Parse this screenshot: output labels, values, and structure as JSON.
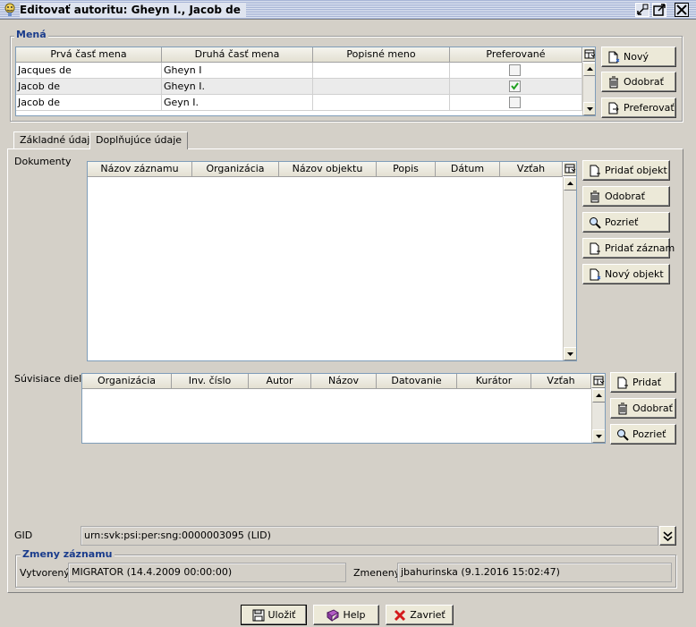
{
  "window": {
    "title": "Editovať autoritu: Gheyn I., Jacob de"
  },
  "names_group": {
    "legend": "Mená",
    "columns": [
      "Prvá časť mena",
      "Druhá časť mena",
      "Popisné meno",
      "Preferované"
    ],
    "rows": [
      {
        "first": "Jacques de",
        "second": "Gheyn I",
        "descriptive": "",
        "preferred": false
      },
      {
        "first": "Jacob de",
        "second": "Gheyn I.",
        "descriptive": "",
        "preferred": true
      },
      {
        "first": "Jacob de",
        "second": "Geyn I.",
        "descriptive": "",
        "preferred": false
      }
    ],
    "buttons": {
      "new": "Nový",
      "remove": "Odobrať",
      "prefer": "Preferovať"
    }
  },
  "tabs": [
    {
      "label": "Základné údaje",
      "active": false
    },
    {
      "label": "Doplňujúce údaje",
      "active": true
    }
  ],
  "documents": {
    "label": "Dokumenty",
    "columns": [
      "Názov záznamu",
      "Organizácia",
      "Názov objektu",
      "Popis",
      "Dátum",
      "Vzťah"
    ],
    "buttons": {
      "add_object": "Pridať objekt",
      "remove": "Odobrať",
      "view": "Pozrieť",
      "add_record": "Pridať záznam",
      "new_object": "Nový objekt"
    }
  },
  "related": {
    "label": "Súvisiace diela",
    "columns": [
      "Organizácia",
      "Inv. číslo",
      "Autor",
      "Názov",
      "Datovanie",
      "Kurátor",
      "Vzťah"
    ],
    "buttons": {
      "add": "Pridať",
      "remove": "Odobrať",
      "view": "Pozrieť"
    }
  },
  "gid": {
    "label": "GID",
    "value": "urn:svk:psi:per:sng:0000003095 (LID)"
  },
  "changes": {
    "legend": "Zmeny záznamu",
    "created_label": "Vytvorený",
    "created_value": "MIGRATOR (14.4.2009 00:00:00)",
    "changed_label": "Zmenený",
    "changed_value": "jbahurinska (9.1.2016 15:02:47)"
  },
  "footer": {
    "save": "Uložiť",
    "help": "Help",
    "close": "Zavrieť"
  },
  "colors": {
    "legend": "#1a3c8c",
    "frame": "#d4d0c8",
    "selected_row": "#ebebeb"
  }
}
